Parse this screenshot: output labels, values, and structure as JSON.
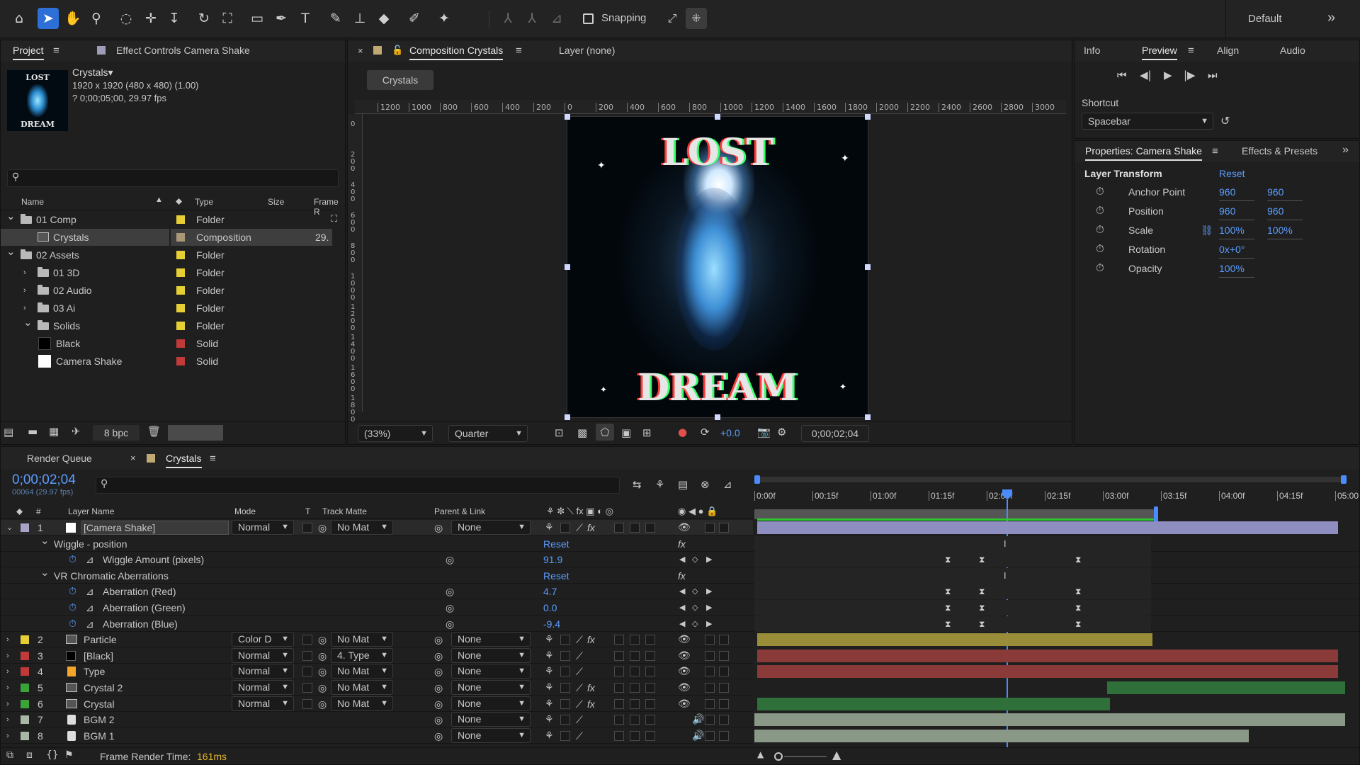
{
  "workspace": {
    "name": "Default",
    "more": "»"
  },
  "toolbar": {
    "snapping_label": "Snapping"
  },
  "project": {
    "tabs": {
      "project": "Project",
      "effect_controls": "Effect Controls Camera Shake"
    },
    "thumb_text_top": "LOST",
    "thumb_text_bottom": "DREAM",
    "comp_name": "Crystals▾",
    "comp_size": "1920 x 1920  (480 x 480) (1.00)",
    "comp_duration": "? 0;00;05;00, 29.97 fps",
    "search_placeholder": "",
    "columns": {
      "name": "Name",
      "type": "Type",
      "size": "Size",
      "frame": "Frame R"
    },
    "items": [
      {
        "name": "01 Comp",
        "type": "Folder",
        "color": "#e6cf35",
        "kind": "folder",
        "indent": 0,
        "exp": "⌄"
      },
      {
        "name": "Crystals",
        "type": "Composition",
        "color": "#a99776",
        "kind": "comp",
        "indent": 1,
        "exp": "",
        "frame": "29."
      },
      {
        "name": "02 Assets",
        "type": "Folder",
        "color": "#e6cf35",
        "kind": "folder",
        "indent": 0,
        "exp": "⌄"
      },
      {
        "name": "01 3D",
        "type": "Folder",
        "color": "#e6cf35",
        "kind": "folder",
        "indent": 1,
        "exp": "›"
      },
      {
        "name": "02 Audio",
        "type": "Folder",
        "color": "#e6cf35",
        "kind": "folder",
        "indent": 1,
        "exp": "›"
      },
      {
        "name": "03 Ai",
        "type": "Folder",
        "color": "#e6cf35",
        "kind": "folder",
        "indent": 1,
        "exp": "›"
      },
      {
        "name": "Solids",
        "type": "Folder",
        "color": "#e6cf35",
        "kind": "folder",
        "indent": 1,
        "exp": "⌄"
      },
      {
        "name": "Black",
        "type": "Solid",
        "color": "#c03a3a",
        "kind": "solid-black",
        "indent": 2,
        "exp": ""
      },
      {
        "name": "Camera Shake",
        "type": "Solid",
        "color": "#c03a3a",
        "kind": "solid-white",
        "indent": 2,
        "exp": ""
      }
    ],
    "bpc": "8 bpc"
  },
  "composition": {
    "tab": "Composition Crystals",
    "layer_tab": "Layer (none)",
    "breadcrumb": "Crystals",
    "ruler_h": [
      "1200",
      "1000",
      "800",
      "600",
      "400",
      "200",
      "0",
      "200",
      "400",
      "600",
      "800",
      "1000",
      "1200",
      "1400",
      "1600",
      "1800",
      "2000",
      "2200",
      "2400",
      "2600",
      "2800",
      "3000"
    ],
    "ruler_v": [
      "0",
      "200",
      "400",
      "600",
      "800",
      "1000",
      "1200",
      "1400",
      "1600",
      "1800"
    ],
    "art_top": "LOST",
    "art_bottom": "DREAM",
    "zoom": "(33%)",
    "resolution": "Quarter",
    "exposure": "+0.0",
    "timecode": "0;00;02;04"
  },
  "info_panel": {
    "tabs": [
      "Info",
      "Preview",
      "Align",
      "Audio"
    ],
    "shortcut_label": "Shortcut",
    "shortcut_value": "Spacebar"
  },
  "properties": {
    "tabs": {
      "properties": "Properties: Camera Shake",
      "effects": "Effects & Presets"
    },
    "section": "Layer Transform",
    "reset": "Reset",
    "rows": [
      {
        "label": "Anchor Point",
        "v1": "960",
        "v2": "960"
      },
      {
        "label": "Position",
        "v1": "960",
        "v2": "960"
      },
      {
        "label": "Scale",
        "v1": "100%",
        "v2": "100%"
      },
      {
        "label": "Rotation",
        "v1": "0x+0°",
        "v2": ""
      },
      {
        "label": "Opacity",
        "v1": "100%",
        "v2": ""
      }
    ]
  },
  "timeline": {
    "tabs": {
      "render_queue": "Render Queue",
      "crystals": "Crystals"
    },
    "timecode": "0;00;02;04",
    "frame_info": "00064 (29.97 fps)",
    "headers": {
      "num": "#",
      "layer_name": "Layer Name",
      "mode": "Mode",
      "t": "T",
      "track_matte": "Track Matte",
      "parent": "Parent & Link"
    },
    "ruler": [
      "0:00f",
      "00:15f",
      "01:00f",
      "01:15f",
      "02:00f",
      "02:15f",
      "03:00f",
      "03:15f",
      "04:00f",
      "04:15f",
      "05:00"
    ],
    "footer": {
      "label": "Frame Render Time:",
      "value": "161ms"
    },
    "rows": [
      {
        "kind": "layer",
        "num": "1",
        "name": "[Camera Shake]",
        "color": "#a8a4c8",
        "icon": "solid-white",
        "mode": "Normal",
        "matte": "No Mat",
        "parent": "None",
        "fx": true,
        "selected": true
      },
      {
        "kind": "group",
        "name": "Wiggle - position",
        "reset": "Reset"
      },
      {
        "kind": "prop",
        "name": "Wiggle Amount (pixels)",
        "value": "91.9"
      },
      {
        "kind": "group",
        "name": "VR Chromatic Aberrations",
        "reset": "Reset"
      },
      {
        "kind": "prop",
        "name": "Aberration (Red)",
        "value": "4.7"
      },
      {
        "kind": "prop",
        "name": "Aberration (Green)",
        "value": "0.0"
      },
      {
        "kind": "prop",
        "name": "Aberration (Blue)",
        "value": "-9.4"
      },
      {
        "kind": "layer",
        "num": "2",
        "name": "Particle",
        "color": "#e6cf35",
        "icon": "comp",
        "mode": "Color D",
        "matte": "No Mat",
        "parent": "None",
        "fx": true
      },
      {
        "kind": "layer",
        "num": "3",
        "name": "[Black]",
        "color": "#c03a3a",
        "icon": "solid-black",
        "mode": "Normal",
        "matte": "4. Type",
        "parent": "None",
        "fx": false
      },
      {
        "kind": "layer",
        "num": "4",
        "name": "Type",
        "color": "#c03a3a",
        "icon": "ai",
        "mode": "Normal",
        "matte": "No Mat",
        "parent": "None",
        "fx": false
      },
      {
        "kind": "layer",
        "num": "5",
        "name": "Crystal 2",
        "color": "#3aa33a",
        "icon": "comp",
        "mode": "Normal",
        "matte": "No Mat",
        "parent": "None",
        "fx": true
      },
      {
        "kind": "layer",
        "num": "6",
        "name": "Crystal",
        "color": "#3aa33a",
        "icon": "comp",
        "mode": "Normal",
        "matte": "No Mat",
        "parent": "None",
        "fx": true
      },
      {
        "kind": "layer",
        "num": "7",
        "name": "BGM 2",
        "color": "#a9b8a6",
        "icon": "audio",
        "mode": "",
        "matte": "",
        "parent": "None",
        "fx": false
      },
      {
        "kind": "layer",
        "num": "8",
        "name": "BGM 1",
        "color": "#a9b8a6",
        "icon": "audio",
        "mode": "",
        "matte": "",
        "parent": "None",
        "fx": false
      }
    ]
  }
}
